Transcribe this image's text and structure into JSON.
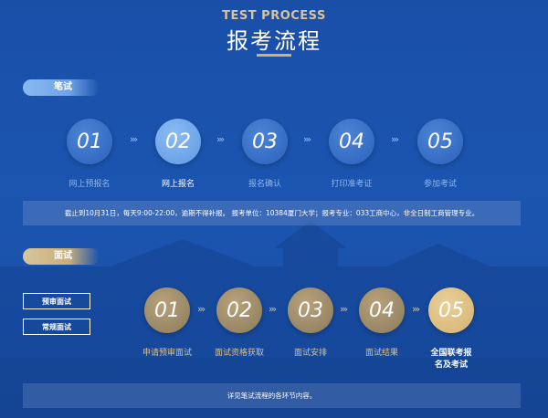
{
  "header": {
    "title_en": "TEST PROCESS",
    "title_cn": "报考流程"
  },
  "written": {
    "section_label": "笔试",
    "steps": [
      {
        "num": "01",
        "label": "网上预报名"
      },
      {
        "num": "02",
        "label": "网上报名"
      },
      {
        "num": "03",
        "label": "报名确认"
      },
      {
        "num": "04",
        "label": "打印准考证"
      },
      {
        "num": "05",
        "label": "参加考试"
      }
    ],
    "active_step": "02",
    "notice": "截止到10月31日，每天9:00-22:00，逾期不得补报。 报考单位：10384厦门大学；报考专业：033工商中心，非全日制工商管理专业。"
  },
  "interview": {
    "section_label": "面试",
    "buttons": [
      "预审面试",
      "常规面试"
    ],
    "steps": [
      {
        "num": "01",
        "label": "申请预审面试"
      },
      {
        "num": "02",
        "label": "面试资格获取"
      },
      {
        "num": "03",
        "label": "面试安排"
      },
      {
        "num": "04",
        "label": "面试结果"
      },
      {
        "num": "05",
        "label": "全国联考报名及考试"
      }
    ],
    "active_step": "05",
    "notice": "详见笔试流程的各环节内容。"
  },
  "arrow_glyph": "›››",
  "colors": {
    "bg": "#1a4fa8",
    "gold": "#d6b371",
    "active_blue": "#6fa4ea"
  }
}
